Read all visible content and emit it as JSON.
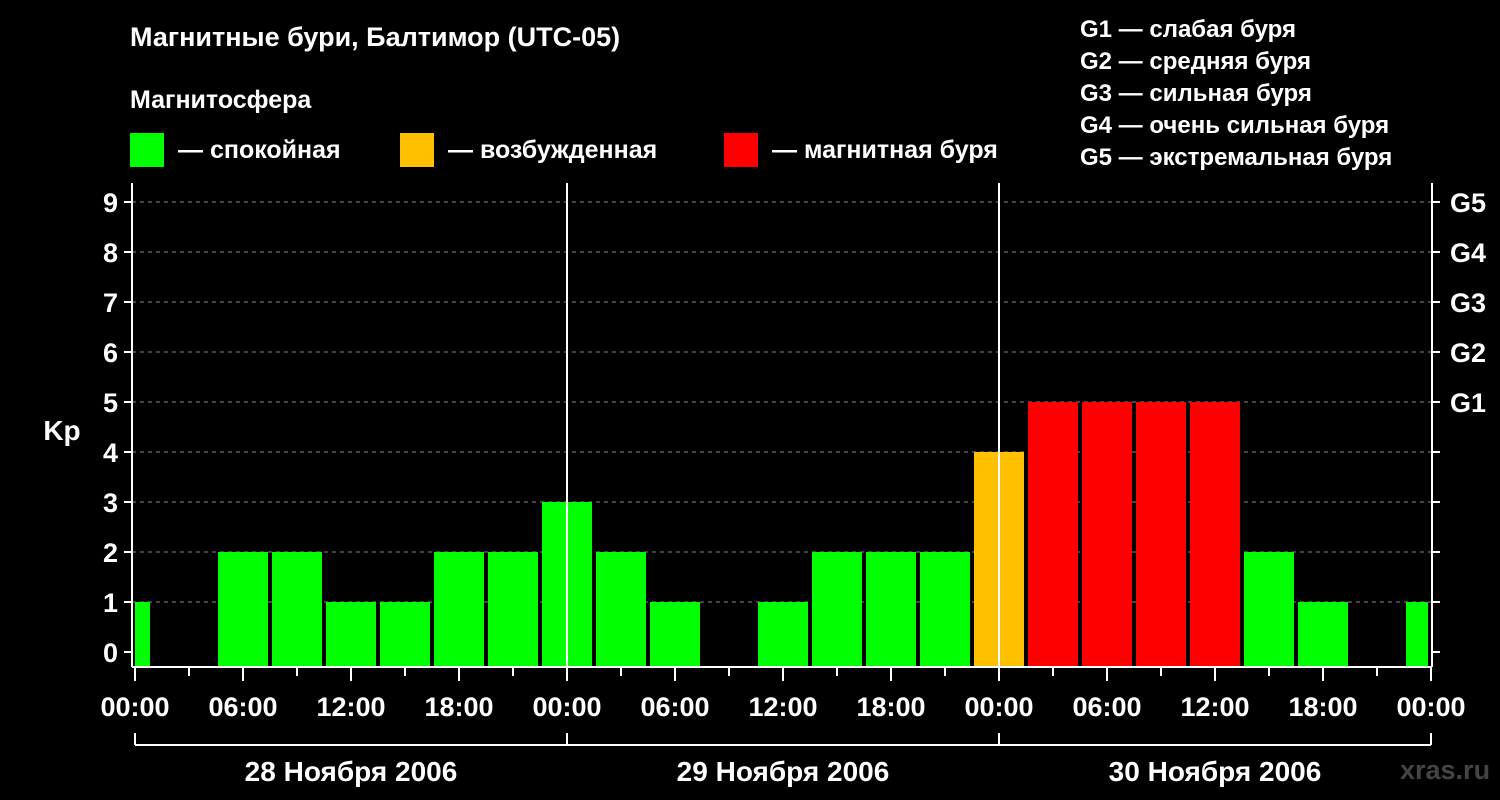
{
  "header": {
    "title": "Магнитные бури, Балтимор (UTC-05)",
    "subtitle": "Магнитосфера"
  },
  "legend": [
    {
      "label": "— спокойная",
      "color": "#00ff00"
    },
    {
      "label": "— возбужденная",
      "color": "#ffc000"
    },
    {
      "label": "— магнитная буря",
      "color": "#ff0000"
    }
  ],
  "storm_scale": [
    "G1 — слабая буря",
    "G2 — средняя буря",
    "G3 — сильная буря",
    "G4 — очень сильная буря",
    "G5 — экстремальная буря"
  ],
  "watermark": "xras.ru",
  "chart_data": {
    "type": "bar",
    "title": "Магнитные бури, Балтимор (UTC-05)",
    "ylabel": "Kp",
    "ylim": [
      0,
      9
    ],
    "yticks": [
      "0",
      "1",
      "2",
      "3",
      "4",
      "5",
      "6",
      "7",
      "8",
      "9"
    ],
    "right_axis_labels": [
      {
        "kp": 5,
        "label": "G1"
      },
      {
        "kp": 6,
        "label": "G2"
      },
      {
        "kp": 7,
        "label": "G3"
      },
      {
        "kp": 8,
        "label": "G4"
      },
      {
        "kp": 9,
        "label": "G5"
      }
    ],
    "x_ticks": [
      "00:00",
      "06:00",
      "12:00",
      "18:00",
      "00:00",
      "06:00",
      "12:00",
      "18:00",
      "00:00",
      "06:00",
      "12:00",
      "18:00",
      "00:00"
    ],
    "dates": [
      "28 Ноября 2006",
      "29 Ноября 2006",
      "30 Ноября 2006"
    ],
    "grid": true,
    "x_start_hour": -1.5,
    "x_end_hour": 70.5,
    "series": [
      {
        "start_hours": [
          -1.5,
          1.5,
          4.5,
          7.5,
          10.5,
          13.5,
          16.5,
          19.5,
          22.5,
          25.5,
          28.5,
          31.5,
          34.5,
          37.5,
          40.5,
          43.5,
          46.5,
          49.5,
          52.5,
          55.5,
          58.5,
          61.5,
          64.5,
          67.5
        ],
        "values": [
          1,
          0,
          2,
          2,
          1,
          1,
          2,
          2,
          3,
          2,
          1,
          0,
          1,
          2,
          2,
          2,
          4,
          5,
          5,
          5,
          5,
          2,
          1,
          0,
          1
        ]
      }
    ],
    "kp_values": [
      1,
      0,
      2,
      2,
      1,
      1,
      2,
      2,
      3,
      2,
      1,
      0,
      1,
      2,
      2,
      2,
      4,
      5,
      5,
      5,
      5,
      2,
      1,
      0,
      1
    ],
    "color_rules": {
      "quiet_max": 3,
      "active": 4,
      "storm_min": 5
    }
  }
}
